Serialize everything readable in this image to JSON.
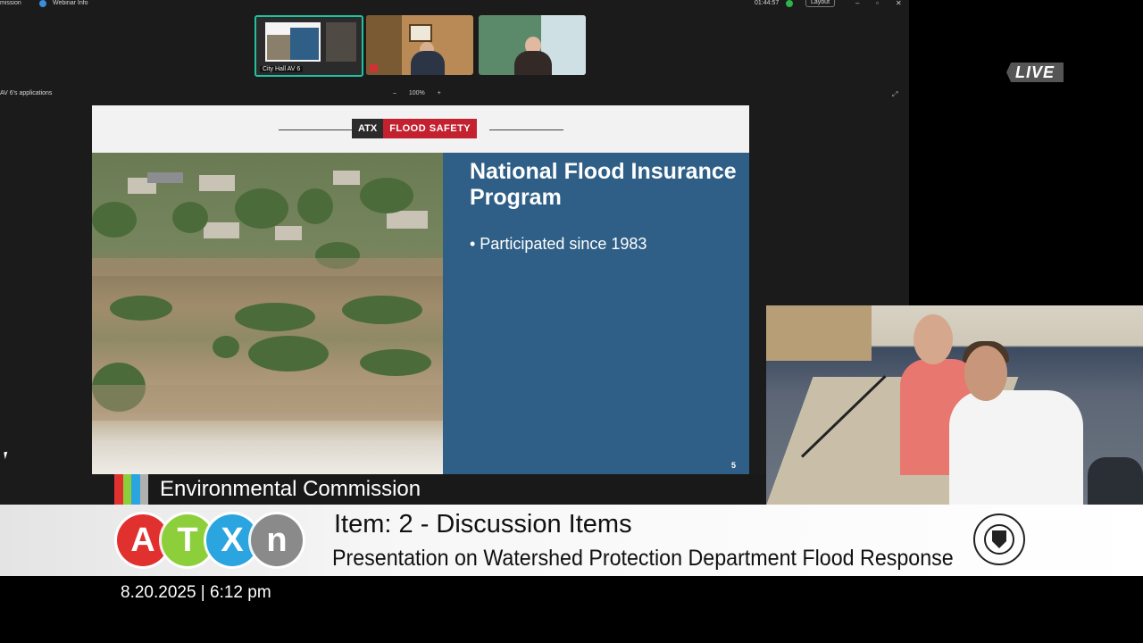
{
  "zoom": {
    "left_label": "mission",
    "webinar_label": "Webinar Info",
    "timer": "01:44:57",
    "layout_button": "Layout",
    "window_controls": [
      "–",
      "▫",
      "✕"
    ],
    "apps_label": "AV 6's applications",
    "zoom_controls": {
      "minus": "–",
      "level": "100%",
      "plus": "+"
    },
    "thumbnails": [
      {
        "label": "City Hall AV 6"
      }
    ]
  },
  "slide": {
    "brand_left": "ATX",
    "brand_right": "FLOOD SAFETY",
    "title": "National Flood Insurance Program",
    "bullet": "• Participated since 1983",
    "page_number": "5",
    "colors": {
      "panel": "#2f5f86",
      "brand_red": "#c42130"
    }
  },
  "live_badge": "LIVE",
  "lower_third": {
    "commission": "Environmental Commission",
    "stripe_colors": [
      "#e0312f",
      "#8ccf3a",
      "#2aa5e0",
      "#b0b0b0"
    ],
    "logo_letters": [
      {
        "char": "A",
        "color": "#e0312f"
      },
      {
        "char": "T",
        "color": "#8ccf3a"
      },
      {
        "char": "X",
        "color": "#2aa5e0"
      },
      {
        "char": "n",
        "color": "#8a8a8a"
      }
    ],
    "item_title": "Item: 2 - Discussion Items",
    "item_subtitle": "Presentation on Watershed Protection Department Flood Response",
    "datetime": "8.20.2025 | 6:12 pm"
  }
}
